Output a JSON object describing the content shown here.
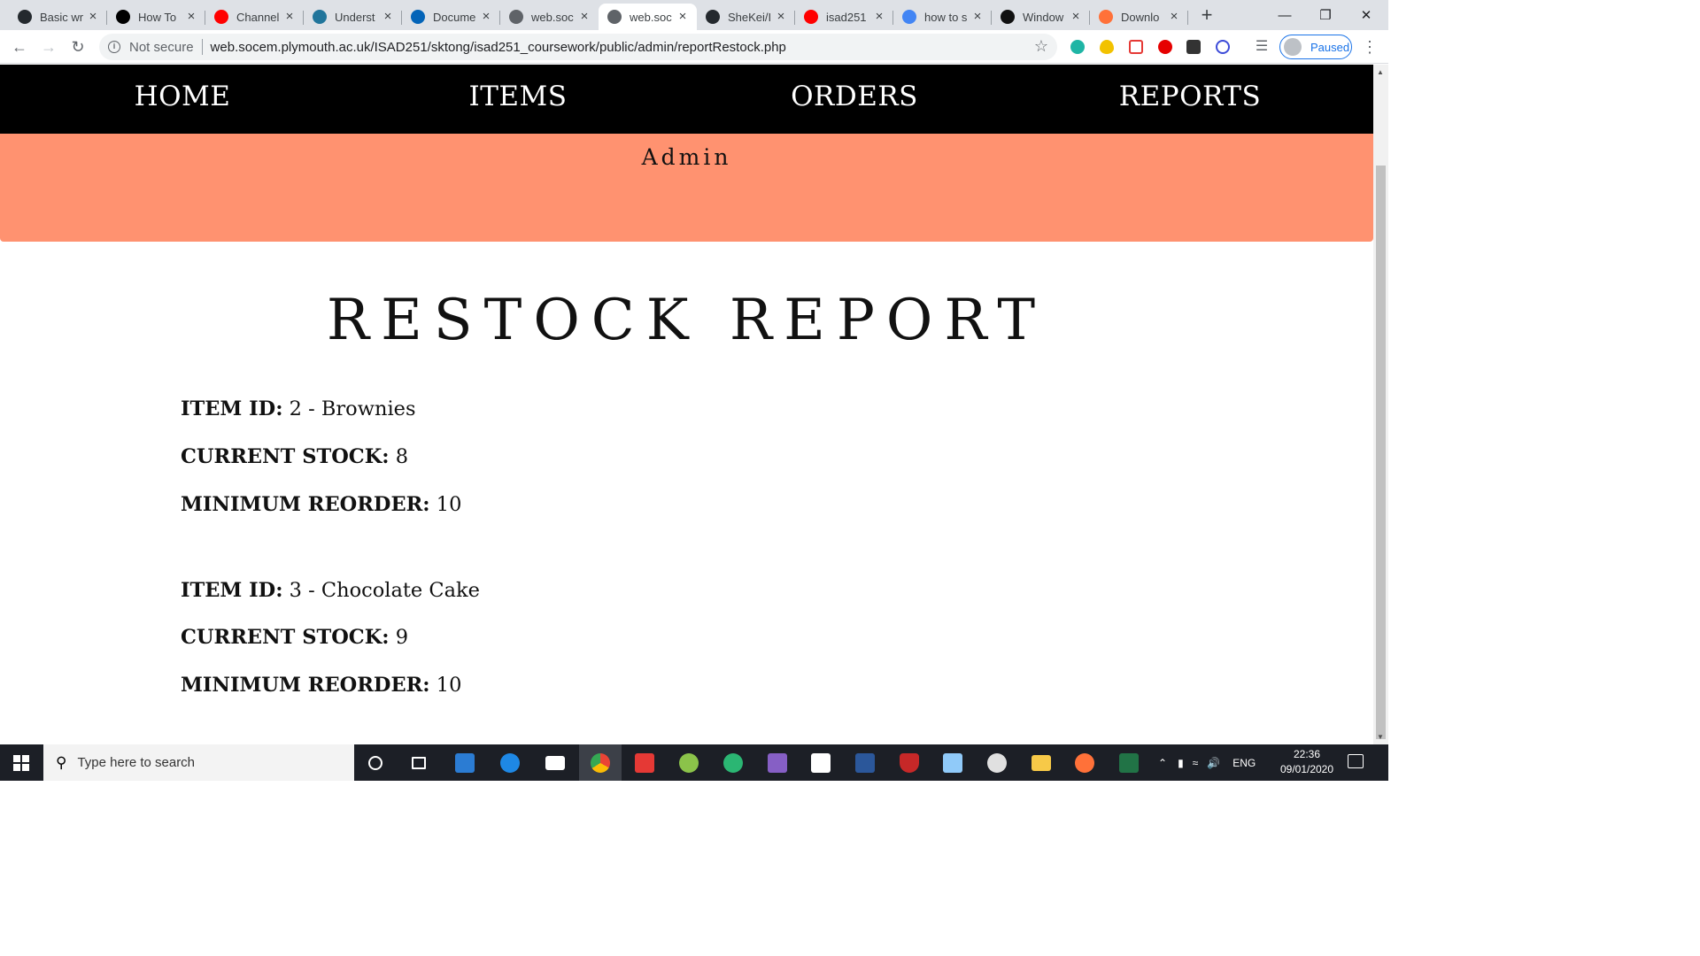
{
  "browser": {
    "tabs": [
      {
        "title": "Basic wr",
        "icon": "github-icon",
        "color": "#24292e"
      },
      {
        "title": "How To",
        "icon": "medium-icon",
        "color": "#000000"
      },
      {
        "title": "Channel",
        "icon": "youtube-icon",
        "color": "#ff0000"
      },
      {
        "title": "Underst",
        "icon": "wordpress-icon",
        "color": "#21759b"
      },
      {
        "title": "Docume",
        "icon": "onedrive-icon",
        "color": "#0364b8"
      },
      {
        "title": "web.soc",
        "icon": "globe-icon",
        "color": "#5f6368"
      },
      {
        "title": "web.soc",
        "icon": "globe-icon",
        "color": "#5f6368",
        "active": true
      },
      {
        "title": "SheKei/I",
        "icon": "github-icon",
        "color": "#24292e"
      },
      {
        "title": "isad251",
        "icon": "youtube-icon",
        "color": "#ff0000"
      },
      {
        "title": "how to s",
        "icon": "google-icon",
        "color": "#4285f4"
      },
      {
        "title": "Window",
        "icon": "g-icon",
        "color": "#111111"
      },
      {
        "title": "Downlo",
        "icon": "firefox-icon",
        "color": "#ff7139"
      }
    ],
    "not_secure": "Not secure",
    "url": "web.socem.plymouth.ac.uk/ISAD251/sktong/isad251_coursework/public/admin/reportRestock.php",
    "profile_label": "Paused"
  },
  "site": {
    "nav": [
      "HOME",
      "ITEMS",
      "ORDERS",
      "REPORTS"
    ],
    "role": "Admin",
    "page_title": "RESTOCK REPORT",
    "labels": {
      "item_id": "ITEM ID:",
      "current_stock": "CURRENT STOCK:",
      "minimum_reorder": "MINIMUM REORDER:"
    },
    "items": [
      {
        "item": "2 - Brownies",
        "current_stock": "8",
        "minimum_reorder": "10"
      },
      {
        "item": "3 - Chocolate Cake",
        "current_stock": "9",
        "minimum_reorder": "10"
      }
    ],
    "colors": {
      "nav_bg": "#000000",
      "hero_bg": "#ff9270"
    }
  },
  "taskbar": {
    "search_placeholder": "Type here to search",
    "language": "ENG",
    "time": "22:36",
    "date": "09/01/2020"
  }
}
